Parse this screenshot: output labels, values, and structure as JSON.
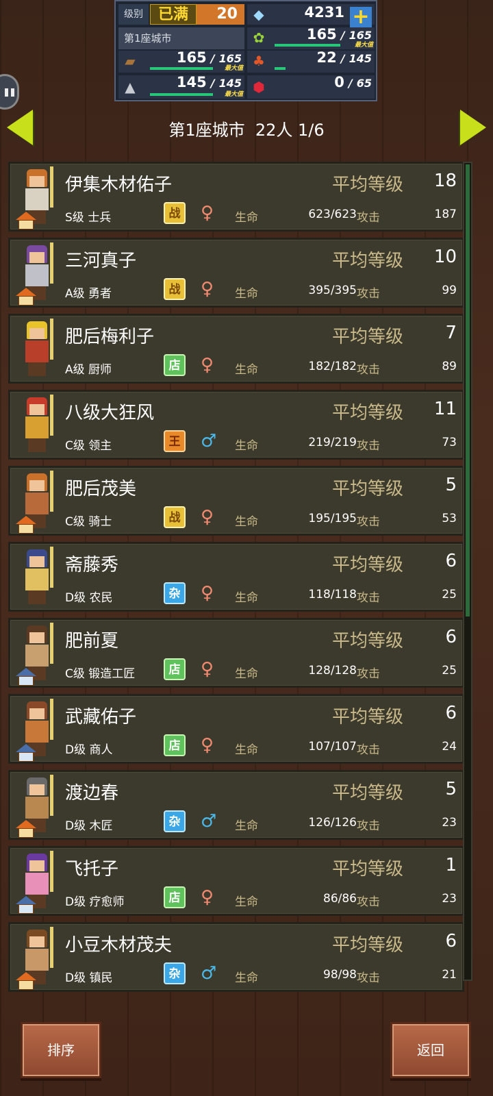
{
  "status": {
    "level_label": "级别",
    "level_badge": "已满",
    "level_value": "20",
    "gems": "4231",
    "city_name": "第1座城市",
    "wood": {
      "current": "165",
      "max": "165",
      "cap_label": "最大值",
      "fill": 1.0
    },
    "grass": {
      "current": "165",
      "max": "165",
      "cap_label": "最大值",
      "fill": 1.0
    },
    "stone": {
      "current": "145",
      "max": "145",
      "cap_label": "最大值",
      "fill": 1.0
    },
    "food": {
      "current": "22",
      "max": "145",
      "fill": 0.15
    },
    "ruby": {
      "current": "0",
      "max": "65",
      "fill": 0.0
    },
    "icons": [
      "diamond-icon",
      "plus-icon",
      "grass-icon",
      "wood-icon",
      "food-icon",
      "stone-icon",
      "ruby-icon"
    ]
  },
  "header": {
    "title": "第1座城市  22人 1/6"
  },
  "list": {
    "avg_label": "平均等级",
    "hp_label": "生命",
    "atk_label": "攻击",
    "rows": [
      {
        "name": "伊集木材佑子",
        "level": "18",
        "rank": "S级 士兵",
        "type": "战",
        "gender": "♀",
        "gender_class": "g-f",
        "hp": "623/623",
        "atk": "187",
        "house": "home",
        "hair": "#c9702a",
        "body": "#d9d2c2"
      },
      {
        "name": "三河真子",
        "level": "10",
        "rank": "A级 勇者",
        "type": "战",
        "gender": "♀",
        "gender_class": "g-f",
        "hp": "395/395",
        "atk": "99",
        "house": "home",
        "hair": "#7a4aa0",
        "body": "#c0c0c8"
      },
      {
        "name": "肥后梅利子",
        "level": "7",
        "rank": "A级 厨师",
        "type": "店",
        "gender": "♀",
        "gender_class": "g-f",
        "hp": "182/182",
        "atk": "89",
        "house": "none",
        "hair": "#e8c42a",
        "body": "#b8402a"
      },
      {
        "name": "八级大狂风",
        "level": "11",
        "rank": "C级 领主",
        "type": "王",
        "gender": "♂",
        "gender_class": "g-m",
        "hp": "219/219",
        "atk": "73",
        "house": "none",
        "hair": "#c83a2a",
        "body": "#d8a030"
      },
      {
        "name": "肥后茂美",
        "level": "5",
        "rank": "C级 骑士",
        "type": "战",
        "gender": "♀",
        "gender_class": "g-f",
        "hp": "195/195",
        "atk": "53",
        "house": "home",
        "hair": "#c9702a",
        "body": "#b86a3a"
      },
      {
        "name": "斋藤秀",
        "level": "6",
        "rank": "D级 农民",
        "type": "杂",
        "gender": "♀",
        "gender_class": "g-f",
        "hp": "118/118",
        "atk": "25",
        "house": "none",
        "hair": "#3a4a8a",
        "body": "#e0c060"
      },
      {
        "name": "肥前夏",
        "level": "6",
        "rank": "C级 锻造工匠",
        "type": "店",
        "gender": "♀",
        "gender_class": "g-f",
        "hp": "128/128",
        "atk": "25",
        "house": "flat",
        "hair": "#5a3a22",
        "body": "#c8a070"
      },
      {
        "name": "武藏佑子",
        "level": "6",
        "rank": "D级 商人",
        "type": "店",
        "gender": "♀",
        "gender_class": "g-f",
        "hp": "107/107",
        "atk": "24",
        "house": "flat",
        "hair": "#8a4a2a",
        "body": "#c87838"
      },
      {
        "name": "渡边春",
        "level": "5",
        "rank": "D级 木匠",
        "type": "杂",
        "gender": "♂",
        "gender_class": "g-m",
        "hp": "126/126",
        "atk": "23",
        "house": "home",
        "hair": "#6a6a6a",
        "body": "#b88850"
      },
      {
        "name": "飞托子",
        "level": "1",
        "rank": "D级 疗愈师",
        "type": "店",
        "gender": "♀",
        "gender_class": "g-f",
        "hp": "86/86",
        "atk": "23",
        "house": "flat",
        "hair": "#6a3aa0",
        "body": "#e890b8"
      },
      {
        "name": "小豆木材茂夫",
        "level": "6",
        "rank": "D级 镇民",
        "type": "杂",
        "gender": "♂",
        "gender_class": "g-m",
        "hp": "98/98",
        "atk": "21",
        "house": "home",
        "hair": "#7a4a22",
        "body": "#c89868"
      }
    ]
  },
  "buttons": {
    "sort": "排序",
    "back": "返回"
  }
}
